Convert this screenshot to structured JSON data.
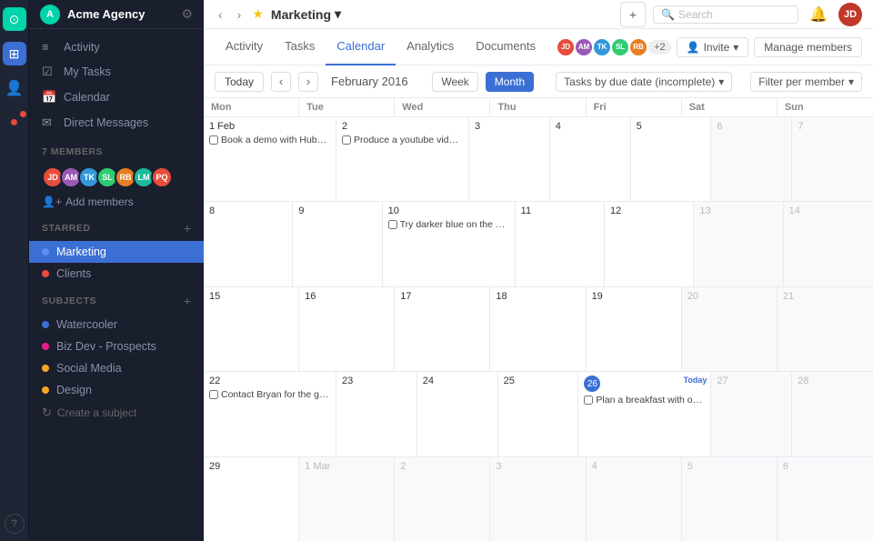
{
  "app": {
    "name": "Acme Agency"
  },
  "iconBar": {
    "items": [
      {
        "name": "home-icon",
        "symbol": "⊙",
        "active": "green"
      },
      {
        "name": "grid-icon",
        "symbol": "⊞",
        "active": "blue"
      },
      {
        "name": "person-icon",
        "symbol": "👤",
        "active": false
      },
      {
        "name": "notification-icon",
        "symbol": "●",
        "active": false,
        "badge": true
      }
    ]
  },
  "sidebar": {
    "nav": [
      {
        "label": "Activity",
        "icon": "≡"
      },
      {
        "label": "My Tasks",
        "icon": "☑"
      },
      {
        "label": "Calendar",
        "icon": "📅"
      },
      {
        "label": "Direct Messages",
        "icon": "✉"
      }
    ],
    "members": {
      "count": "7 MEMBERS",
      "add_label": "Add members"
    },
    "starred": {
      "section_title": "STARRED",
      "items": [
        {
          "label": "Marketing",
          "dot_color": "#3b6fd4",
          "active": true
        },
        {
          "label": "Clients",
          "dot_color": "#e74c3c"
        }
      ]
    },
    "subjects": {
      "section_title": "SUBJECTS",
      "items": [
        {
          "label": "Watercooler",
          "dot_color": "#3b6fd4"
        },
        {
          "label": "Biz Dev - Prospects",
          "dot_color": "#e91e8c"
        },
        {
          "label": "Social Media",
          "dot_color": "#f5a623"
        },
        {
          "label": "Design",
          "dot_color": "#f5a623"
        }
      ],
      "create_label": "Create a subject"
    }
  },
  "header": {
    "nav_prev": "‹",
    "nav_next": "›",
    "title": "Marketing",
    "title_arrow": "▾",
    "search_placeholder": "Search",
    "plus_icon": "+",
    "bell_icon": "🔔",
    "user_initials": "JD"
  },
  "tabs": {
    "items": [
      {
        "label": "Activity"
      },
      {
        "label": "Tasks"
      },
      {
        "label": "Calendar",
        "active": true
      },
      {
        "label": "Analytics"
      },
      {
        "label": "Documents"
      }
    ],
    "member_avatars": [
      {
        "initials": "JD",
        "color": "#e74c3c"
      },
      {
        "initials": "AM",
        "color": "#9b59b6"
      },
      {
        "initials": "TK",
        "color": "#3498db"
      },
      {
        "initials": "SL",
        "color": "#2ecc71"
      },
      {
        "initials": "RB",
        "color": "#e67e22"
      }
    ],
    "plus_count": "+2",
    "invite_label": "Invite",
    "manage_label": "Manage members"
  },
  "calendar": {
    "today_btn": "Today",
    "month_label": "February 2016",
    "view_week": "Week",
    "view_month": "Month",
    "filter_label": "Tasks by due date (incomplete)",
    "filter_per_label": "Filter per member",
    "days": [
      "Mon",
      "Tue",
      "Wed",
      "Thu",
      "Fri",
      "Sat",
      "Sun"
    ],
    "weeks": [
      {
        "cells": [
          {
            "date": "1 Feb",
            "tasks": [
              "Book a demo with Hubspot"
            ]
          },
          {
            "date": "2",
            "tasks": [
              "Produce a youtube video for"
            ]
          },
          {
            "date": "3",
            "tasks": []
          },
          {
            "date": "4",
            "tasks": []
          },
          {
            "date": "5",
            "tasks": []
          },
          {
            "date": "6",
            "tasks": [],
            "other": true
          },
          {
            "date": "7",
            "tasks": [],
            "other": true
          }
        ]
      },
      {
        "cells": [
          {
            "date": "8",
            "tasks": []
          },
          {
            "date": "9",
            "tasks": []
          },
          {
            "date": "10",
            "tasks": [
              "Try darker blue on the mobil"
            ]
          },
          {
            "date": "11",
            "tasks": []
          },
          {
            "date": "12",
            "tasks": []
          },
          {
            "date": "13",
            "tasks": [],
            "other": true
          },
          {
            "date": "14",
            "tasks": [],
            "other": true
          }
        ]
      },
      {
        "cells": [
          {
            "date": "15",
            "tasks": []
          },
          {
            "date": "16",
            "tasks": []
          },
          {
            "date": "17",
            "tasks": []
          },
          {
            "date": "18",
            "tasks": []
          },
          {
            "date": "19",
            "tasks": []
          },
          {
            "date": "20",
            "tasks": [],
            "other": true
          },
          {
            "date": "21",
            "tasks": [],
            "other": true
          }
        ]
      },
      {
        "cells": [
          {
            "date": "22",
            "tasks": [
              "Contact Bryan for the greeti"
            ]
          },
          {
            "date": "23",
            "tasks": []
          },
          {
            "date": "24",
            "tasks": []
          },
          {
            "date": "25",
            "tasks": []
          },
          {
            "date": "26",
            "tasks": [
              "Plan a breakfast with our pa"
            ],
            "today": true
          },
          {
            "date": "27",
            "tasks": [],
            "other": true
          },
          {
            "date": "28",
            "tasks": [],
            "other": true
          }
        ]
      },
      {
        "cells": [
          {
            "date": "29",
            "tasks": []
          },
          {
            "date": "1 Mar",
            "tasks": [],
            "other": true
          },
          {
            "date": "2",
            "tasks": [],
            "other": true
          },
          {
            "date": "3",
            "tasks": [],
            "other": true
          },
          {
            "date": "4",
            "tasks": [],
            "other": true
          },
          {
            "date": "5",
            "tasks": [],
            "other": true
          },
          {
            "date": "6",
            "tasks": [],
            "other": true
          }
        ]
      }
    ]
  }
}
